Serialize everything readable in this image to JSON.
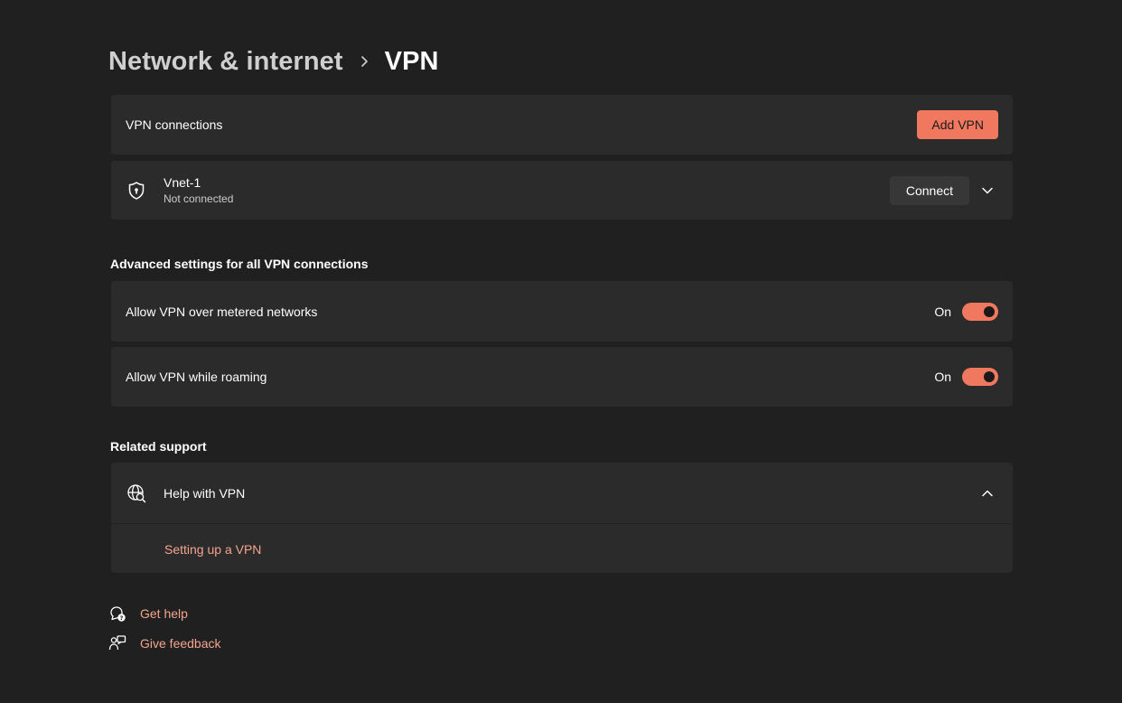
{
  "breadcrumb": {
    "parent": "Network & internet",
    "separator_icon": "chevron-right-icon",
    "current": "VPN"
  },
  "vpn_connections": {
    "label": "VPN connections",
    "add_button": "Add VPN"
  },
  "connection": {
    "icon": "shield-icon",
    "name": "Vnet-1",
    "status": "Not connected",
    "connect_button": "Connect",
    "expand_icon": "chevron-down-icon"
  },
  "advanced": {
    "title": "Advanced settings for all VPN connections",
    "settings": [
      {
        "label": "Allow VPN over metered networks",
        "state_text": "On",
        "on": true
      },
      {
        "label": "Allow VPN while roaming",
        "state_text": "On",
        "on": true
      }
    ]
  },
  "related_support": {
    "title": "Related support",
    "help_icon": "globe-search-icon",
    "help_label": "Help with VPN",
    "collapse_icon": "chevron-up-icon",
    "links": [
      "Setting up a VPN"
    ]
  },
  "footer": {
    "get_help": "Get help",
    "give_feedback": "Give feedback"
  },
  "colors": {
    "background": "#202020",
    "card": "#2b2b2b",
    "accent": "#f0785f",
    "link": "#f3a48e"
  }
}
